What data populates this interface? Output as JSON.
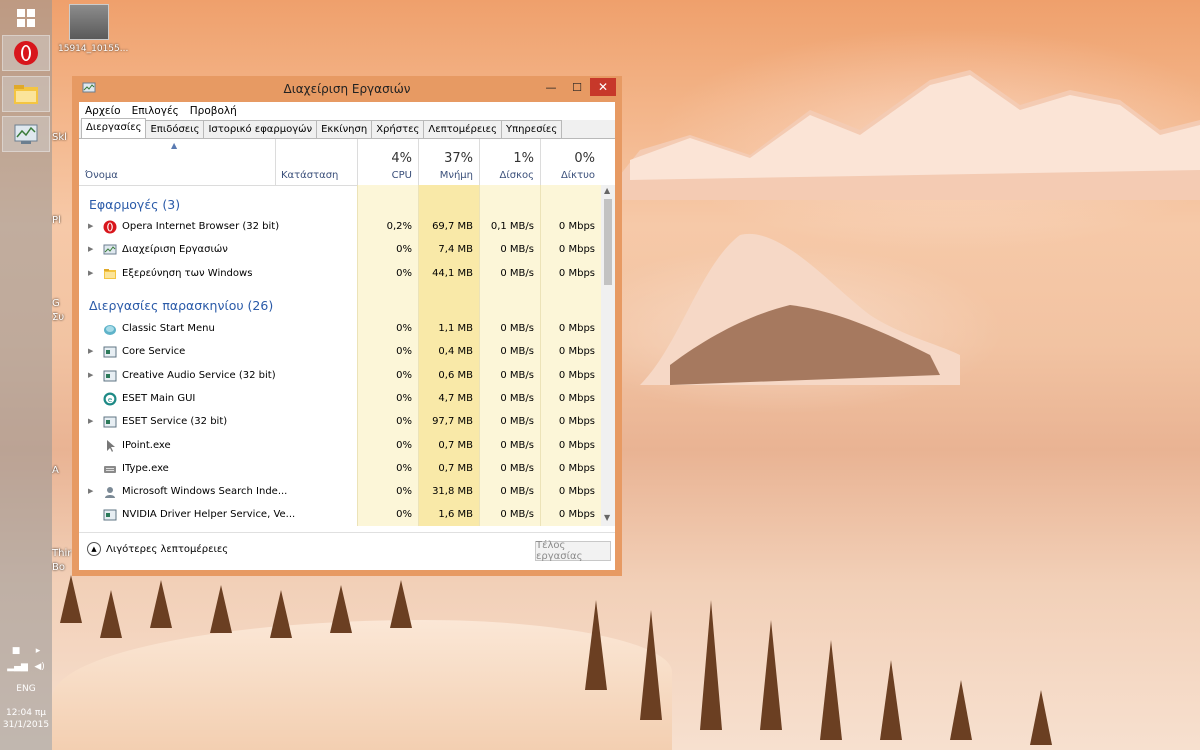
{
  "window": {
    "title": "Διαχείριση Εργασιών",
    "min_glyph": "—",
    "max_glyph": "☐",
    "close_glyph": "✕"
  },
  "menu": [
    "Αρχείο",
    "Επιλογές",
    "Προβολή"
  ],
  "tabs": [
    "Διεργασίες",
    "Επιδόσεις",
    "Ιστορικό εφαρμογών",
    "Εκκίνηση",
    "Χρήστες",
    "Λεπτομέρειες",
    "Υπηρεσίες"
  ],
  "columns": {
    "name": "Όνομα",
    "status": "Κατάσταση",
    "cpu": {
      "pct": "4%",
      "label": "CPU"
    },
    "memory": {
      "pct": "37%",
      "label": "Μνήμη"
    },
    "disk": {
      "pct": "1%",
      "label": "Δίσκος"
    },
    "network": {
      "pct": "0%",
      "label": "Δίκτυο"
    }
  },
  "groups": {
    "apps": "Εφαρμογές (3)",
    "background": "Διεργασίες παρασκηνίου (26)"
  },
  "apps": [
    {
      "name": "Opera Internet Browser (32 bit)",
      "cpu": "0,2%",
      "mem": "69,7 MB",
      "disk": "0,1 MB/s",
      "net": "0 Mbps",
      "icon": "opera-icon",
      "expand": true
    },
    {
      "name": "Διαχείριση Εργασιών",
      "cpu": "0%",
      "mem": "7,4 MB",
      "disk": "0 MB/s",
      "net": "0 Mbps",
      "icon": "task-manager-icon",
      "expand": true
    },
    {
      "name": "Εξερεύνηση των Windows",
      "cpu": "0%",
      "mem": "44,1 MB",
      "disk": "0 MB/s",
      "net": "0 Mbps",
      "icon": "explorer-folder-icon",
      "expand": true
    }
  ],
  "background": [
    {
      "name": "Classic Start Menu",
      "cpu": "0%",
      "mem": "1,1 MB",
      "disk": "0 MB/s",
      "net": "0 Mbps",
      "icon": "classic-shell-icon",
      "expand": false
    },
    {
      "name": "Core Service",
      "cpu": "0%",
      "mem": "0,4 MB",
      "disk": "0 MB/s",
      "net": "0 Mbps",
      "icon": "service-window-icon",
      "expand": true
    },
    {
      "name": "Creative Audio Service (32 bit)",
      "cpu": "0%",
      "mem": "0,6 MB",
      "disk": "0 MB/s",
      "net": "0 Mbps",
      "icon": "service-window-icon",
      "expand": true
    },
    {
      "name": "ESET Main GUI",
      "cpu": "0%",
      "mem": "4,7 MB",
      "disk": "0 MB/s",
      "net": "0 Mbps",
      "icon": "eset-icon",
      "expand": false
    },
    {
      "name": "ESET Service (32 bit)",
      "cpu": "0%",
      "mem": "97,7 MB",
      "disk": "0 MB/s",
      "net": "0 Mbps",
      "icon": "service-window-icon",
      "expand": true
    },
    {
      "name": "IPoint.exe",
      "cpu": "0%",
      "mem": "0,7 MB",
      "disk": "0 MB/s",
      "net": "0 Mbps",
      "icon": "mouse-pointer-icon",
      "expand": false
    },
    {
      "name": "IType.exe",
      "cpu": "0%",
      "mem": "0,7 MB",
      "disk": "0 MB/s",
      "net": "0 Mbps",
      "icon": "keyboard-icon",
      "expand": false
    },
    {
      "name": "Microsoft Windows Search Inde...",
      "cpu": "0%",
      "mem": "31,8 MB",
      "disk": "0 MB/s",
      "net": "0 Mbps",
      "icon": "search-indexer-icon",
      "expand": true
    },
    {
      "name": "NVIDIA Driver Helper Service, Ve...",
      "cpu": "0%",
      "mem": "1,6 MB",
      "disk": "0 MB/s",
      "net": "0 Mbps",
      "icon": "service-window-icon",
      "expand": false
    }
  ],
  "footer": {
    "fewer_details": "Λιγότερες λεπτομέρειες",
    "end_task": "Τέλος εργασίας"
  },
  "desktop": {
    "icon_label": "15914_10155...",
    "fragments": [
      "Skl",
      "Pl",
      "G",
      "Συ",
      "Α",
      "Thir",
      "Bo"
    ]
  },
  "tray": {
    "lang": "ENG",
    "time": "12:04 πμ",
    "date": "31/1/2015"
  },
  "colors": {
    "window_frame": "#e79a63",
    "close_button": "#c7382a",
    "group_header": "#2a5aa8",
    "heat_light": "#fcf6d8",
    "heat_mid": "#fbeeb4",
    "heat_strong": "#f9e49a"
  }
}
